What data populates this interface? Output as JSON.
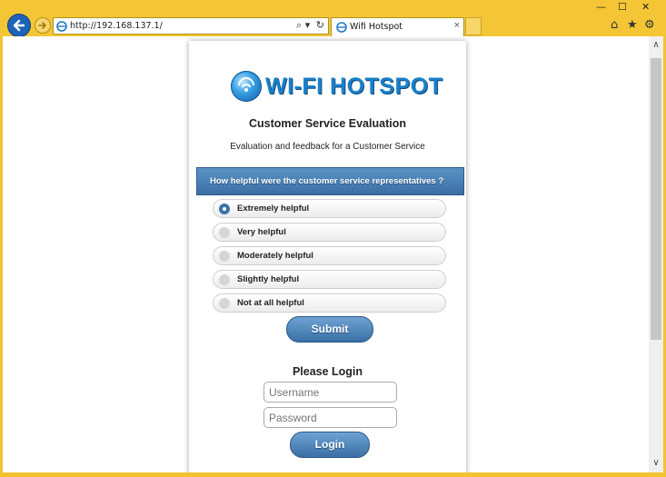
{
  "browser": {
    "window_controls": {
      "minimize": "—",
      "maximize": "☐",
      "close": "✕"
    },
    "address": {
      "url": "http://192.168.137.1/",
      "search_symbol": "⌕ ▾",
      "refresh_symbol": "↻"
    },
    "tab": {
      "title": "Wifi Hotspot",
      "close_symbol": "×"
    },
    "toolbar": {
      "home_symbol": "⌂",
      "favorites_symbol": "★",
      "settings_symbol": "⚙"
    },
    "scrollbar": {
      "up_symbol": "∧",
      "down_symbol": "∨"
    },
    "colors": {
      "frame": "#f4c635",
      "back_button": "#1d63b8"
    }
  },
  "page": {
    "logo_text": "WI-FI HOTSPOT",
    "title": "Customer Service Evaluation",
    "subtitle": "Evaluation and feedback for a Customer Service",
    "question": "How helpful were the customer service representatives ?",
    "options": [
      {
        "label": "Extremely helpful",
        "checked": true
      },
      {
        "label": "Very helpful",
        "checked": false
      },
      {
        "label": "Moderately helpful",
        "checked": false
      },
      {
        "label": "Slightly helpful",
        "checked": false
      },
      {
        "label": "Not at all helpful",
        "checked": false
      }
    ],
    "submit_label": "Submit",
    "login": {
      "title": "Please Login",
      "username_placeholder": "Username",
      "password_placeholder": "Password",
      "button_label": "Login"
    },
    "colors": {
      "accent": "#3b6fa3",
      "logo": "#1a80c8"
    }
  }
}
